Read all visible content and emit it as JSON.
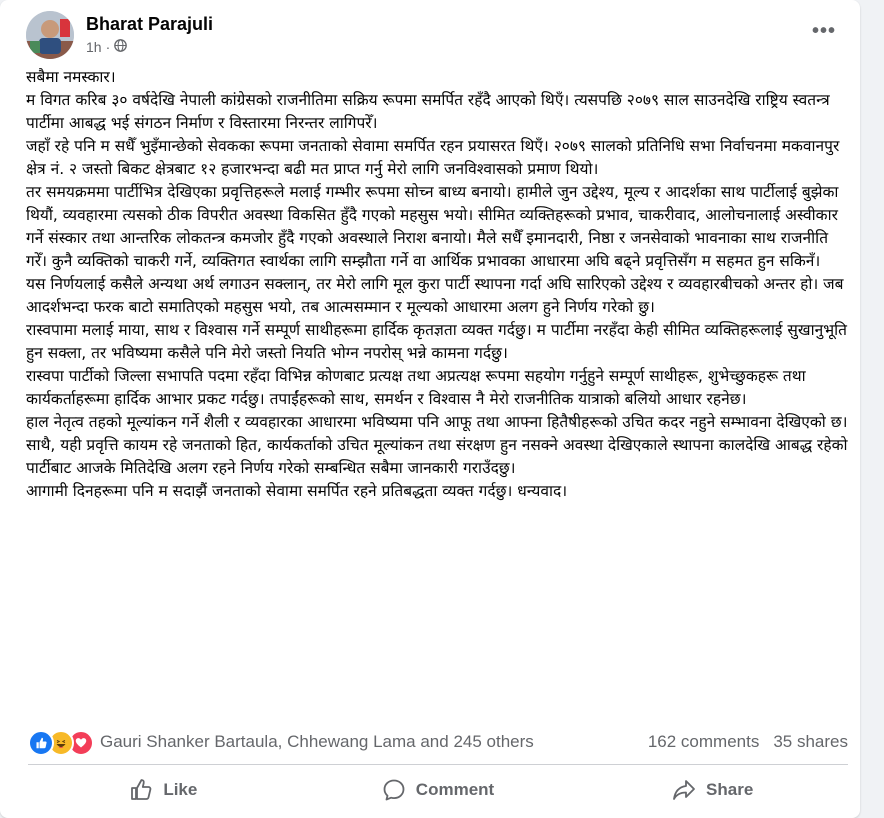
{
  "post": {
    "author": "Bharat Parajuli",
    "time": "1h",
    "audience_icon": "globe-icon",
    "menu_icon": "more-options-icon",
    "paragraphs": [
      "सबैमा नमस्कार।",
      "म विगत करिब ३० वर्षदेखि नेपाली कांग्रेसको राजनीतिमा सक्रिय रूपमा समर्पित रहँदै आएको थिएँ। त्यसपछि २०७९ साल साउनदेखि राष्ट्रिय स्वतन्त्र पार्टीमा आबद्ध भई संगठन निर्माण र विस्तारमा निरन्तर लागिपरेँ।",
      "जहाँ रहे पनि म सधैँ भुइँमान्छेको सेवकका रूपमा जनताको सेवामा समर्पित रहन प्रयासरत थिएँ। २०७९ सालको प्रतिनिधि सभा निर्वाचनमा मकवानपुर क्षेत्र नं. २ जस्तो बिकट क्षेत्रबाट १२ हजारभन्दा बढी मत प्राप्त गर्नु मेरो लागि जनविश्वासको प्रमाण थियो।",
      "तर समयक्रममा पार्टीभित्र देखिएका प्रवृत्तिहरूले मलाई गम्भीर रूपमा सोच्न बाध्य बनायो। हामीले जुन उद्देश्य, मूल्य र आदर्शका साथ पार्टीलाई बुझेका थियौं, व्यवहारमा त्यसको ठीक विपरीत अवस्था विकसित हुँदै गएको महसुस भयो। सीमित व्यक्तिहरूको प्रभाव, चाकरीवाद, आलोचनालाई अस्वीकार गर्ने संस्कार तथा आन्तरिक लोकतन्त्र कमजोर हुँदै गएको अवस्थाले निराश बनायो। मैले सधैँ इमानदारी, निष्ठा र जनसेवाको भावनाका साथ राजनीति गरेँ। कुनै व्यक्तिको चाकरी गर्ने, व्यक्तिगत स्वार्थका लागि सम्झौता गर्ने वा आर्थिक प्रभावका आधारमा अघि बढ्ने प्रवृत्तिसँग म सहमत हुन सकिनँ।",
      "यस निर्णयलाई कसैले अन्यथा अर्थ लगाउन सक्लान्, तर मेरो लागि मूल कुरा पार्टी स्थापना गर्दा अघि सारिएको उद्देश्य र व्यवहारबीचको अन्तर हो। जब आदर्शभन्दा फरक बाटो समातिएको महसुस भयो, तब आत्मसम्मान र मूल्यको आधारमा अलग हुने निर्णय गरेको छु।",
      "रास्वपामा मलाई माया, साथ र विश्वास गर्ने सम्पूर्ण साथीहरूमा हार्दिक कृतज्ञता व्यक्त गर्दछु। म पार्टीमा नरहँदा केही सीमित व्यक्तिहरूलाई सुखानुभूति हुन सक्ला, तर भविष्यमा कसैले पनि मेरो जस्तो नियति भोग्न नपरोस् भन्ने कामना गर्दछु।",
      "रास्वपा पार्टीको जिल्ला सभापति पदमा रहँदा विभिन्न कोणबाट प्रत्यक्ष तथा अप्रत्यक्ष रूपमा सहयोग गर्नुहुने सम्पूर्ण साथीहरू, शुभेच्छुकहरू तथा कार्यकर्ताहरूमा हार्दिक आभार प्रकट गर्दछु। तपाईंहरूको साथ, समर्थन र विश्वास नै मेरो राजनीतिक यात्राको बलियो आधार रहनेछ।",
      "हाल नेतृत्व तहको मूल्यांकन गर्ने शैली र व्यवहारका आधारमा भविष्यमा पनि आफू तथा आफ्ना हितैषीहरूको उचित कदर नहुने सम्भावना देखिएको छ। साथै, यही प्रवृत्ति कायम रहे जनताको हित, कार्यकर्ताको उचित मूल्यांकन तथा संरक्षण हुन नसक्ने अवस्था देखिएकाले स्थापना कालदेखि आबद्ध रहेको पार्टीबाट आजके मितिदेखि अलग रहने निर्णय गरेको सम्बन्धित सबैमा जानकारी गराउँदछु।",
      "आगामी दिनहरूमा पनि म सदाझैं जनताको सेवामा समर्पित रहने प्रतिबद्धता व्यक्त गर्दछु। धन्यवाद।"
    ]
  },
  "reactions": {
    "icons": [
      "like-reaction-icon",
      "haha-reaction-icon",
      "love-reaction-icon"
    ],
    "summary": "Gauri Shanker Bartaula, Chhewang Lama and 245 others",
    "comments": "162 comments",
    "shares": "35 shares"
  },
  "actions": {
    "like": "Like",
    "comment": "Comment",
    "share": "Share"
  },
  "colors": {
    "like_blue": "#1877f2",
    "love_red": "#f33e58",
    "haha_yellow": "#f7b928",
    "secondary_text": "#65676b"
  }
}
